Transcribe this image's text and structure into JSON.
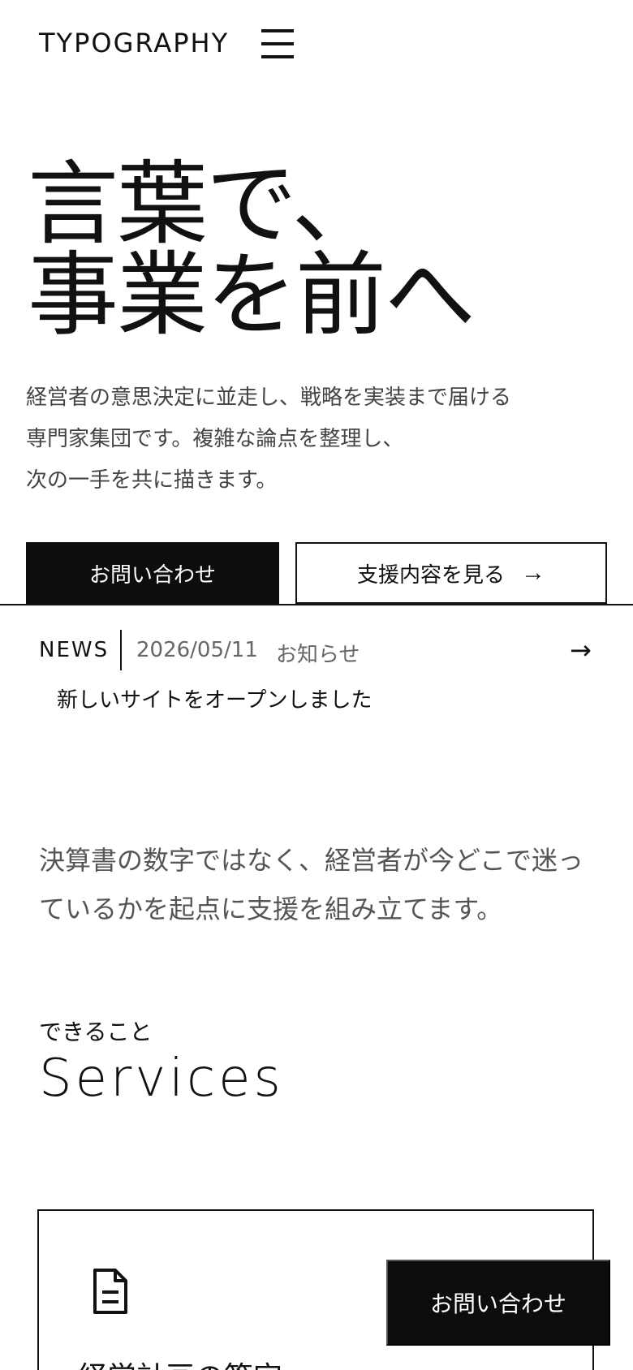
{
  "header": {
    "logo": "TYPOGRAPHY",
    "menu_icon": "hamburger-icon"
  },
  "hero": {
    "title_line1": "言葉で、",
    "title_line2": "事業を前へ",
    "lead_line1": "経営者の意思決定に並走し、戦略を実装まで届ける",
    "lead_line2": "専門家集団です。複雑な論点を整理し、",
    "lead_line3": "次の一手を共に描きます。",
    "primary_button": "お問い合わせ",
    "secondary_button": "支援内容を見る",
    "secondary_icon": "arrow-right-icon"
  },
  "news": {
    "label": "NEWS",
    "date": "2026/05/11",
    "category": "お知らせ",
    "title": "新しいサイトをオープンしました",
    "arrow_icon": "arrow-right-icon"
  },
  "intro": {
    "line1": "決算書の数字ではなく、経営者が今どこで迷っ",
    "line2": "ているかを起点に支援を組み立てます。"
  },
  "services": {
    "kicker": "できること",
    "title": "Services",
    "card": {
      "icon": "document-icon",
      "title": "経営計画の策定"
    }
  },
  "floating_cta": {
    "label": "お問い合わせ"
  },
  "colors": {
    "primary": "#0d0d0d",
    "text": "#111111",
    "muted": "#666666",
    "background": "#ffffff"
  }
}
